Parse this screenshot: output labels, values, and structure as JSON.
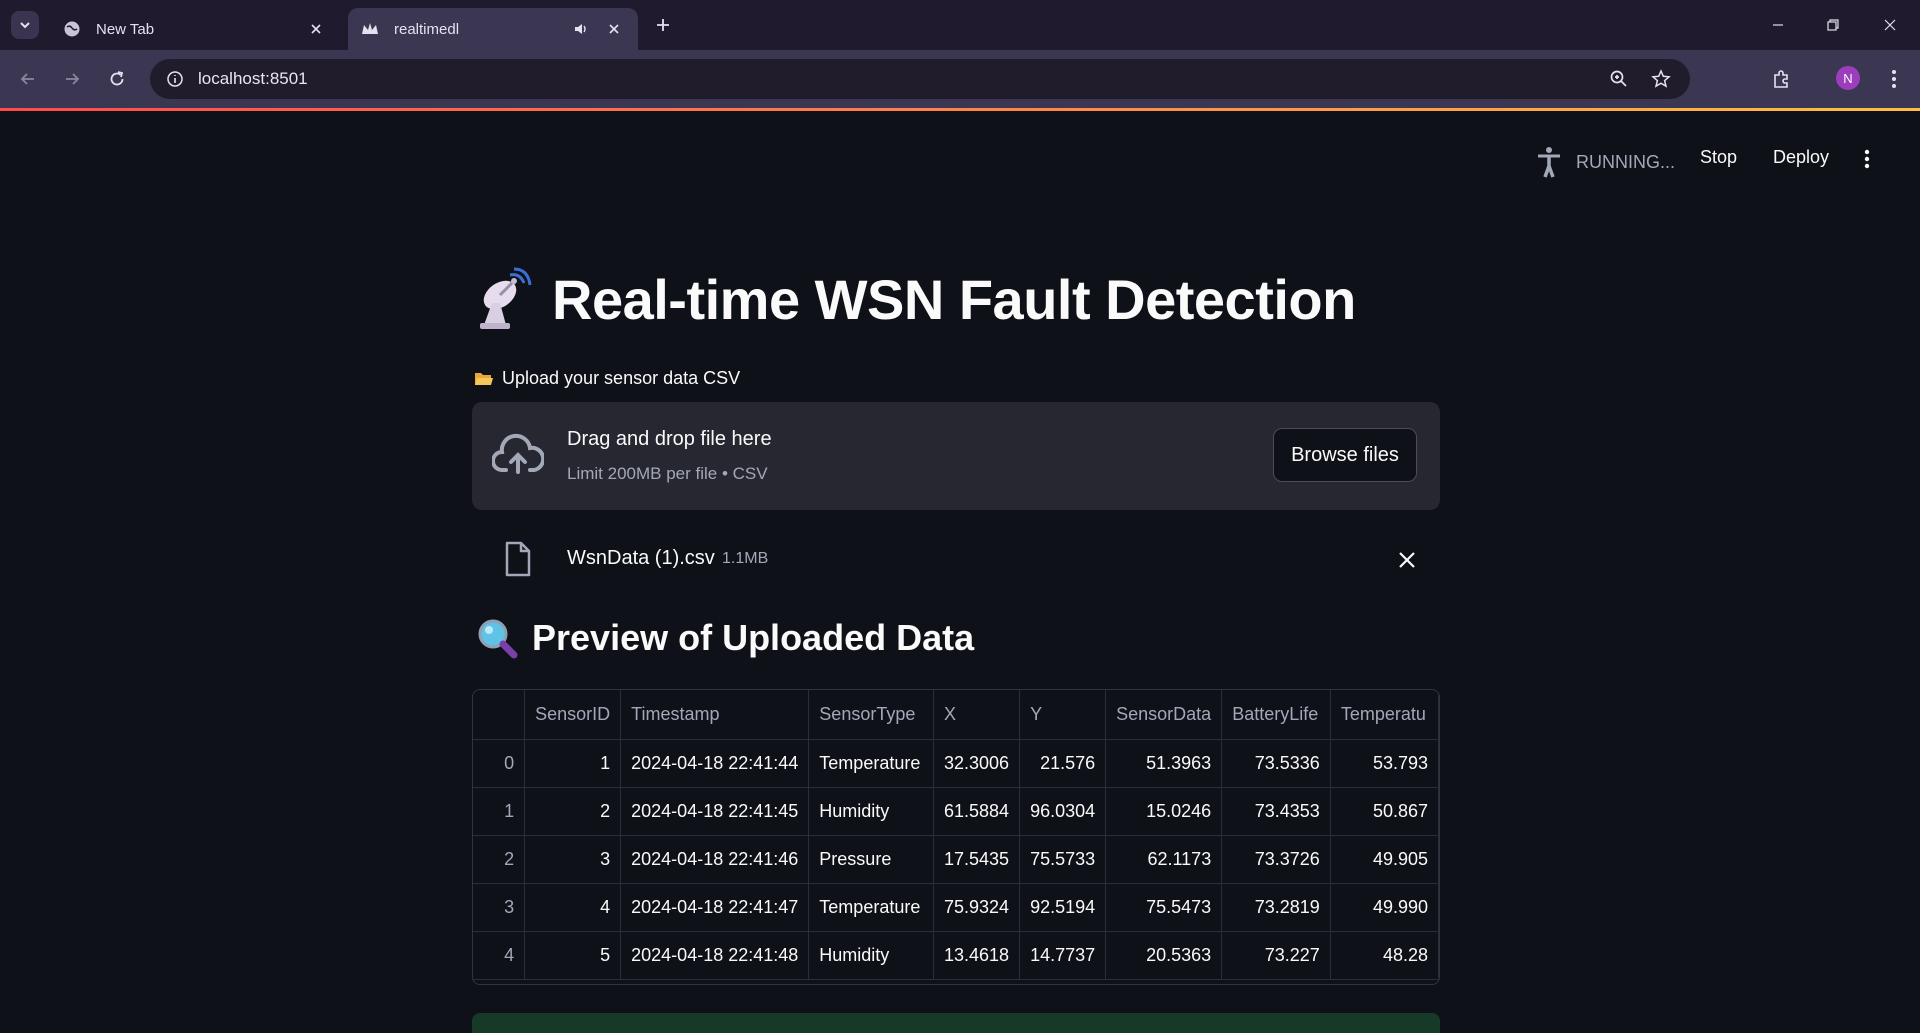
{
  "browser": {
    "tabs": [
      {
        "title": "New Tab",
        "active": false
      },
      {
        "title": "realtimedl",
        "active": true
      }
    ],
    "url": "localhost:8501",
    "profile_initial": "N"
  },
  "header": {
    "status": "RUNNING...",
    "stop_label": "Stop",
    "deploy_label": "Deploy"
  },
  "main": {
    "title": "Real-time WSN Fault Detection",
    "upload_label": "Upload your sensor data CSV",
    "dropzone": {
      "title": "Drag and drop file here",
      "limit": "Limit 200MB per file • CSV",
      "browse_label": "Browse files"
    },
    "file": {
      "name": "WsnData (1).csv",
      "size": "1.1MB"
    },
    "preview_title": "Preview of Uploaded Data",
    "table": {
      "columns": [
        "",
        "SensorID",
        "Timestamp",
        "SensorType",
        "X",
        "Y",
        "SensorData",
        "BatteryLife",
        "Temperatu"
      ],
      "rows": [
        [
          "0",
          "1",
          "2024-04-18 22:41:44",
          "Temperature",
          "32.3006",
          "21.576",
          "51.3963",
          "73.5336",
          "53.793"
        ],
        [
          "1",
          "2",
          "2024-04-18 22:41:45",
          "Humidity",
          "61.5884",
          "96.0304",
          "15.0246",
          "73.4353",
          "50.867"
        ],
        [
          "2",
          "3",
          "2024-04-18 22:41:46",
          "Pressure",
          "17.5435",
          "75.5733",
          "62.1173",
          "73.3726",
          "49.905"
        ],
        [
          "3",
          "4",
          "2024-04-18 22:41:47",
          "Temperature",
          "75.9324",
          "92.5194",
          "75.5473",
          "73.2819",
          "49.990"
        ],
        [
          "4",
          "5",
          "2024-04-18 22:41:48",
          "Humidity",
          "13.4618",
          "14.7737",
          "20.5363",
          "73.227",
          "48.28"
        ]
      ]
    }
  }
}
